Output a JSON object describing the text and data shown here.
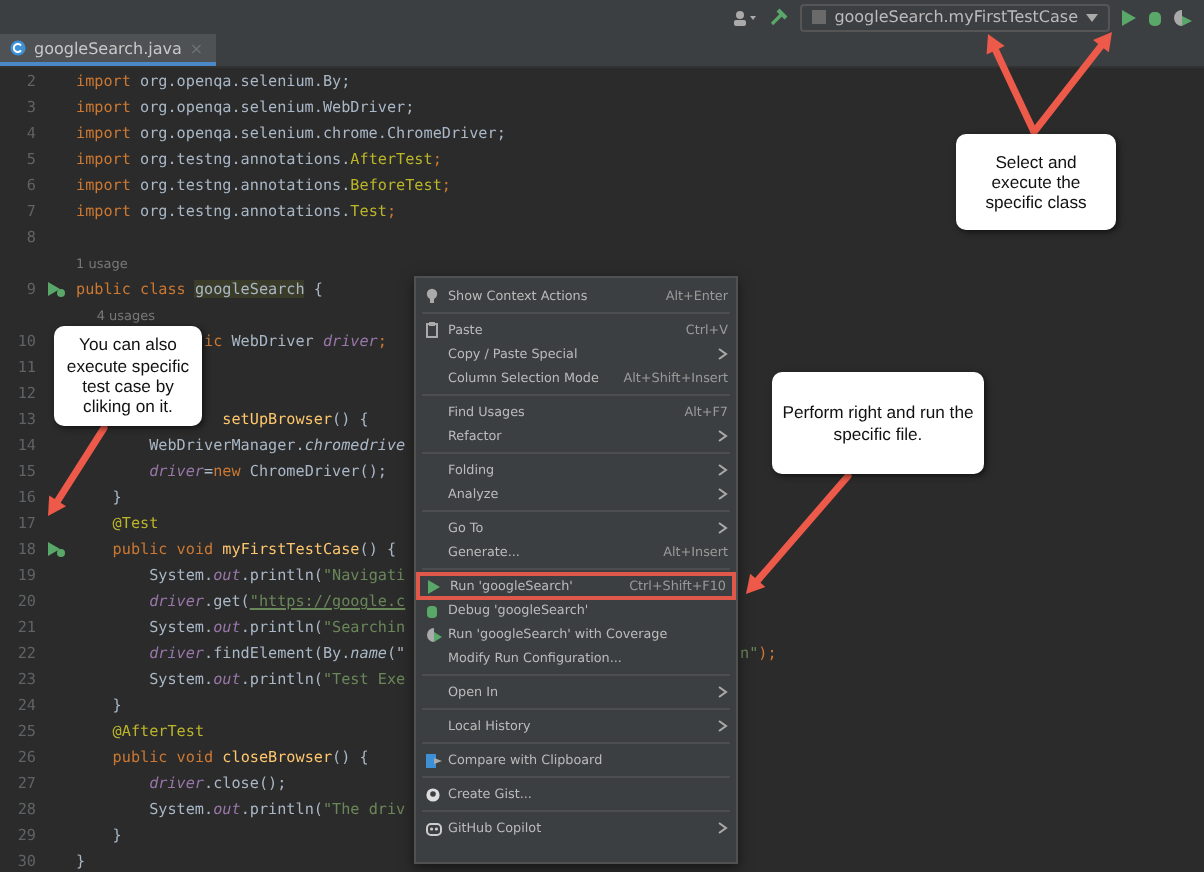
{
  "toolbar": {
    "run_config": "googleSearch.myFirstTestCase"
  },
  "tab": {
    "label": "googleSearch.java",
    "close": "×",
    "selected": true
  },
  "code_lines": [
    {
      "n": "2",
      "marker": false,
      "tokens": [
        {
          "kind": "kw",
          "text": "import "
        },
        {
          "kind": "pl",
          "text": "org.openqa.selenium.By;"
        }
      ]
    },
    {
      "n": "3",
      "marker": false,
      "tokens": [
        {
          "kind": "kw",
          "text": "import "
        },
        {
          "kind": "pl",
          "text": "org.openqa.selenium.WebDriver;"
        }
      ]
    },
    {
      "n": "4",
      "marker": false,
      "tokens": [
        {
          "kind": "kw",
          "text": "import "
        },
        {
          "kind": "pl",
          "text": "org.openqa.selenium.chrome.ChromeDriver;"
        }
      ]
    },
    {
      "n": "5",
      "marker": false,
      "tokens": [
        {
          "kind": "kw",
          "text": "import "
        },
        {
          "kind": "pl",
          "text": "org.testng.annotations."
        },
        {
          "kind": "an",
          "text": "AfterTest"
        },
        {
          "kind": "kw",
          "text": ";"
        }
      ]
    },
    {
      "n": "6",
      "marker": false,
      "tokens": [
        {
          "kind": "kw",
          "text": "import "
        },
        {
          "kind": "pl",
          "text": "org.testng.annotations."
        },
        {
          "kind": "an",
          "text": "BeforeTest"
        },
        {
          "kind": "kw",
          "text": ";"
        }
      ]
    },
    {
      "n": "7",
      "marker": false,
      "tokens": [
        {
          "kind": "kw",
          "text": "import "
        },
        {
          "kind": "pl",
          "text": "org.testng.annotations."
        },
        {
          "kind": "an",
          "text": "Test"
        },
        {
          "kind": "kw",
          "text": ";"
        }
      ]
    },
    {
      "n": "8",
      "marker": false
    },
    {
      "hint": "1 usage"
    },
    {
      "n": "9",
      "marker": true,
      "tokens": [
        {
          "kind": "kw",
          "text": "public class "
        },
        {
          "kind": "hl",
          "text": "googleSearch"
        },
        {
          "kind": "pl",
          "text": " {"
        }
      ]
    },
    {
      "hint": "     4 usages"
    },
    {
      "n": "10",
      "marker": false,
      "tokens": [
        {
          "kind": "kw",
          "text": "              ic "
        },
        {
          "kind": "pl",
          "text": "WebDriver "
        },
        {
          "kind": "fd",
          "text": "driver"
        },
        {
          "kind": "kw",
          "text": ";"
        }
      ]
    },
    {
      "n": "11",
      "marker": false
    },
    {
      "n": "12",
      "marker": false
    },
    {
      "n": "13",
      "marker": false,
      "tokens": [
        {
          "kind": "fn",
          "text": "                setUpBrowser"
        },
        {
          "kind": "pl",
          "text": "() {"
        }
      ]
    },
    {
      "n": "14",
      "marker": false,
      "tokens": [
        {
          "kind": "pl",
          "text": "        WebDriverManager."
        },
        {
          "kind": "it",
          "text": "chromedrive"
        }
      ]
    },
    {
      "n": "15",
      "marker": false,
      "tokens": [
        {
          "kind": "fd",
          "text": "        driver"
        },
        {
          "kind": "pl",
          "text": "="
        },
        {
          "kind": "kw",
          "text": "new "
        },
        {
          "kind": "pl",
          "text": "ChromeDriver();"
        }
      ]
    },
    {
      "n": "16",
      "marker": false,
      "tokens": [
        {
          "kind": "pl",
          "text": "    }"
        }
      ]
    },
    {
      "n": "17",
      "marker": false,
      "tokens": [
        {
          "kind": "an",
          "text": "    @Test"
        }
      ]
    },
    {
      "n": "18",
      "marker": true,
      "tokens": [
        {
          "kind": "kw",
          "text": "    public void "
        },
        {
          "kind": "fn",
          "text": "myFirstTestCase"
        },
        {
          "kind": "pl",
          "text": "() {"
        }
      ]
    },
    {
      "n": "19",
      "marker": false,
      "tokens": [
        {
          "kind": "pl",
          "text": "        System."
        },
        {
          "kind": "fd",
          "text": "out"
        },
        {
          "kind": "pl",
          "text": ".println("
        },
        {
          "kind": "st",
          "text": "\"Navigati"
        }
      ]
    },
    {
      "n": "20",
      "marker": false,
      "tokens": [
        {
          "kind": "fd",
          "text": "        driver"
        },
        {
          "kind": "pl",
          "text": ".get("
        },
        {
          "kind": "ul",
          "text": "\"https://google.c"
        }
      ]
    },
    {
      "n": "21",
      "marker": false,
      "tokens": [
        {
          "kind": "pl",
          "text": "        System."
        },
        {
          "kind": "fd",
          "text": "out"
        },
        {
          "kind": "pl",
          "text": ".println("
        },
        {
          "kind": "st",
          "text": "\"Searchin"
        }
      ]
    },
    {
      "n": "22",
      "marker": false,
      "tokens": [
        {
          "kind": "fd",
          "text": "        driver"
        },
        {
          "kind": "pl",
          "text": ".findElement(By."
        },
        {
          "kind": "it",
          "text": "name"
        },
        {
          "kind": "pl",
          "text": "(\""
        }
      ],
      "tail": [
        {
          "kind": "st",
          "text": "n\""
        },
        {
          "kind": "kw",
          "text": ");"
        }
      ]
    },
    {
      "n": "23",
      "marker": false,
      "tokens": [
        {
          "kind": "pl",
          "text": "        System."
        },
        {
          "kind": "fd",
          "text": "out"
        },
        {
          "kind": "pl",
          "text": ".println("
        },
        {
          "kind": "st",
          "text": "\"Test Exe"
        }
      ]
    },
    {
      "n": "24",
      "marker": false,
      "tokens": [
        {
          "kind": "pl",
          "text": "    }"
        }
      ]
    },
    {
      "n": "25",
      "marker": false,
      "tokens": [
        {
          "kind": "an",
          "text": "    @AfterTest"
        }
      ]
    },
    {
      "n": "26",
      "marker": false,
      "tokens": [
        {
          "kind": "kw",
          "text": "    public void "
        },
        {
          "kind": "fn",
          "text": "closeBrowser"
        },
        {
          "kind": "pl",
          "text": "() {"
        }
      ]
    },
    {
      "n": "27",
      "marker": false,
      "tokens": [
        {
          "kind": "fd",
          "text": "        driver"
        },
        {
          "kind": "pl",
          "text": ".close();"
        }
      ]
    },
    {
      "n": "28",
      "marker": false,
      "tokens": [
        {
          "kind": "pl",
          "text": "        System."
        },
        {
          "kind": "fd",
          "text": "out"
        },
        {
          "kind": "pl",
          "text": ".println("
        },
        {
          "kind": "st",
          "text": "\"The driv"
        }
      ]
    },
    {
      "n": "29",
      "marker": false,
      "tokens": [
        {
          "kind": "pl",
          "text": "    }"
        }
      ]
    },
    {
      "n": "30",
      "marker": false,
      "tokens": [
        {
          "kind": "pl",
          "text": "}"
        }
      ]
    }
  ],
  "context_menu": [
    {
      "kind": "item",
      "label": "Show Context Actions",
      "shortcut": "Alt+Enter",
      "submenu": false,
      "highlighted": false
    },
    {
      "kind": "separator"
    },
    {
      "kind": "item",
      "label": "Paste",
      "shortcut": "Ctrl+V",
      "submenu": false,
      "highlighted": false
    },
    {
      "kind": "item",
      "label": "Copy / Paste Special",
      "submenu": true,
      "highlighted": false
    },
    {
      "kind": "item",
      "label": "Column Selection Mode",
      "shortcut": "Alt+Shift+Insert",
      "submenu": false,
      "highlighted": false
    },
    {
      "kind": "separator"
    },
    {
      "kind": "item",
      "label": "Find Usages",
      "shortcut": "Alt+F7",
      "submenu": false,
      "highlighted": false
    },
    {
      "kind": "item",
      "label": "Refactor",
      "submenu": true,
      "highlighted": false
    },
    {
      "kind": "separator"
    },
    {
      "kind": "item",
      "label": "Folding",
      "submenu": true,
      "highlighted": false
    },
    {
      "kind": "item",
      "label": "Analyze",
      "submenu": true,
      "highlighted": false
    },
    {
      "kind": "separator"
    },
    {
      "kind": "item",
      "label": "Go To",
      "submenu": true,
      "highlighted": false
    },
    {
      "kind": "item",
      "label": "Generate...",
      "shortcut": "Alt+Insert",
      "submenu": false,
      "highlighted": false
    },
    {
      "kind": "separator"
    },
    {
      "kind": "item",
      "label": "Run 'googleSearch'",
      "shortcut": "Ctrl+Shift+F10",
      "submenu": false,
      "highlighted": true
    },
    {
      "kind": "item",
      "label": "Debug 'googleSearch'",
      "submenu": false,
      "highlighted": false
    },
    {
      "kind": "item",
      "label": "Run 'googleSearch' with Coverage",
      "submenu": false,
      "highlighted": false
    },
    {
      "kind": "item",
      "label": "Modify Run Configuration...",
      "submenu": false,
      "highlighted": false
    },
    {
      "kind": "separator"
    },
    {
      "kind": "item",
      "label": "Open In",
      "submenu": true,
      "highlighted": false
    },
    {
      "kind": "separator"
    },
    {
      "kind": "item",
      "label": "Local History",
      "submenu": true,
      "highlighted": false
    },
    {
      "kind": "separator"
    },
    {
      "kind": "item",
      "label": "Compare with Clipboard",
      "submenu": false,
      "highlighted": false
    },
    {
      "kind": "separator"
    },
    {
      "kind": "item",
      "label": "Create Gist...",
      "submenu": false,
      "highlighted": false
    },
    {
      "kind": "separator"
    },
    {
      "kind": "item",
      "label": "GitHub Copilot",
      "submenu": true,
      "highlighted": false
    }
  ],
  "callouts": [
    {
      "kind": "top",
      "text": "Select and execute the specific class"
    },
    {
      "kind": "right",
      "text": "Perform right and run the specific file."
    },
    {
      "kind": "left",
      "text": "You can also execute specific test case by cliking on it."
    }
  ]
}
